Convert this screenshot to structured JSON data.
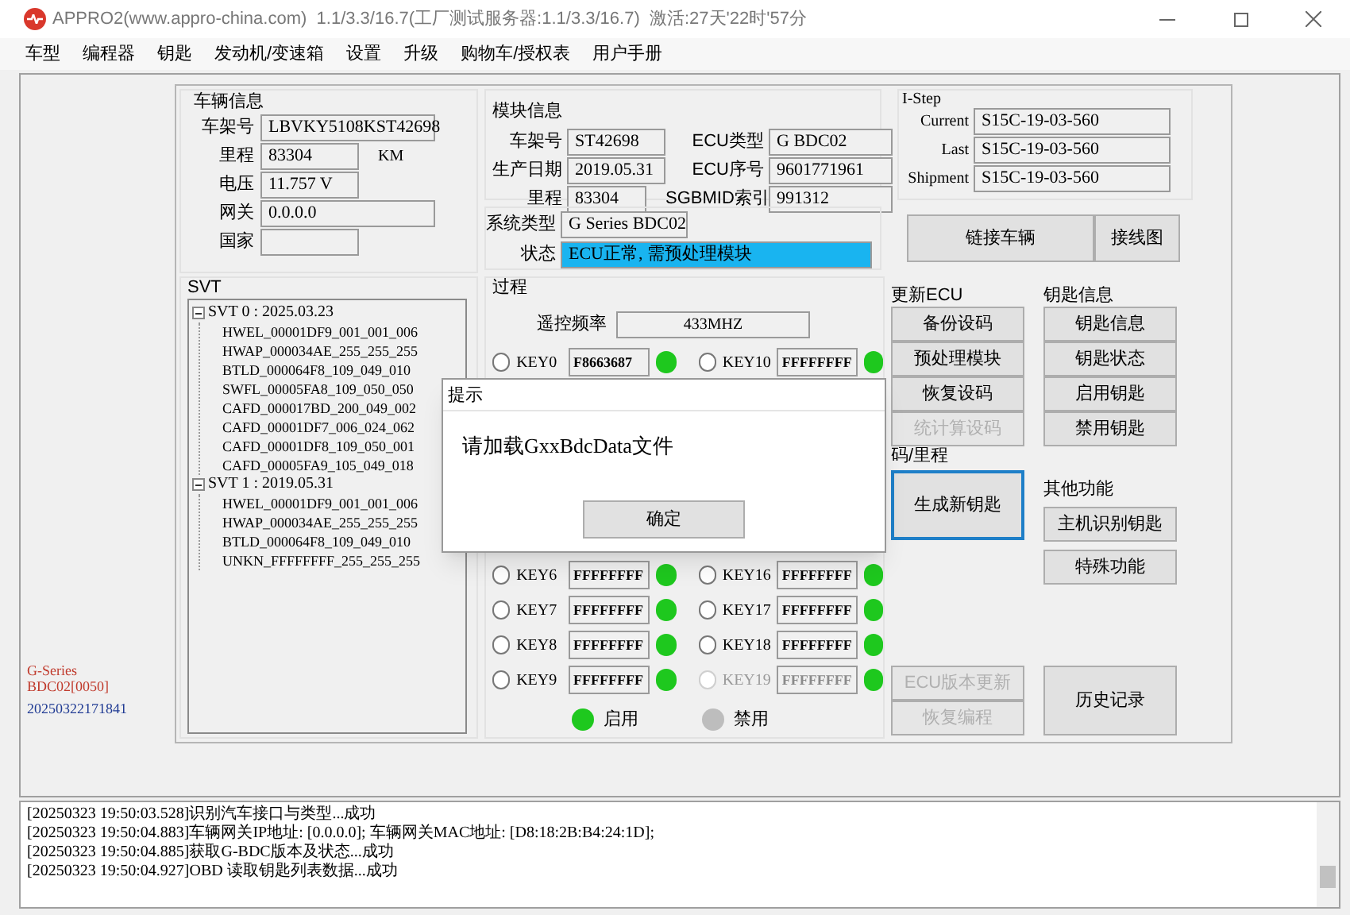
{
  "window": {
    "title": "APPRO2(www.appro-china.com)  1.1/3.3/16.7(工厂测试服务器:1.1/3.3/16.7)  激活:27天'22时'57分"
  },
  "menu": [
    "车型",
    "编程器",
    "钥匙",
    "发动机/变速箱",
    "设置",
    "升级",
    "购物车/授权表",
    "用户手册"
  ],
  "vehicle_info": {
    "title": "车辆信息",
    "fields": [
      {
        "label": "车架号",
        "value": "LBVKY5108KST42698"
      },
      {
        "label": "里程",
        "value": "83304",
        "unit": "KM"
      },
      {
        "label": "电压",
        "value": "11.757 V"
      },
      {
        "label": "网关",
        "value": "0.0.0.0"
      },
      {
        "label": "国家"
      }
    ]
  },
  "module_info": {
    "title": "模块信息",
    "fields": [
      {
        "label": "车架号",
        "value": "ST42698"
      },
      {
        "label": "ECU类型",
        "value": "G BDC02"
      },
      {
        "label": "生产日期",
        "value": "2019.05.31"
      },
      {
        "label": "ECU序号",
        "value": "9601771961"
      },
      {
        "label": "里程",
        "value": "83304"
      },
      {
        "label": "SGBMID索引",
        "value": "991312"
      }
    ]
  },
  "istep": {
    "title": "I-Step",
    "fields": [
      {
        "label": "Current",
        "value": "S15C-19-03-560"
      },
      {
        "label": "Last",
        "value": "S15C-19-03-560"
      },
      {
        "label": "Shipment",
        "value": "S15C-19-03-560"
      }
    ]
  },
  "system": {
    "type_label": "系统类型",
    "type_value": "G Series BDC02",
    "status_label": "状态",
    "status_value": "ECU正常, 需预处理模块",
    "status_highlighted": true
  },
  "connect_buttons": [
    "链接车辆",
    "接线图"
  ],
  "svt": {
    "title": "SVT",
    "tree": [
      {
        "label": "SVT 0 : 2025.03.23",
        "expanded": true,
        "children": [
          {
            "label": "HWEL_00001DF9_001_001_006"
          },
          {
            "label": "HWAP_000034AE_255_255_255"
          },
          {
            "label": "BTLD_000064F8_109_049_010"
          },
          {
            "label": "SWFL_00005FA8_109_050_050"
          },
          {
            "label": "CAFD_000017BD_200_049_002"
          },
          {
            "label": "CAFD_00001DF7_006_024_062"
          },
          {
            "label": "CAFD_00001DF8_109_050_001"
          },
          {
            "label": "CAFD_00005FA9_105_049_018"
          }
        ]
      },
      {
        "label": "SVT 1 : 2019.05.31",
        "expanded": true,
        "children": [
          {
            "label": "HWEL_00001DF9_001_001_006"
          },
          {
            "label": "HWAP_000034AE_255_255_255"
          },
          {
            "label": "BTLD_000064F8_109_049_010"
          },
          {
            "label": "UNKN_FFFFFFFF_255_255_255"
          }
        ]
      }
    ]
  },
  "side_info": [
    {
      "text": "G-Series",
      "color": "#c0392b"
    },
    {
      "text": "BDC02[0050]",
      "color": "#c0392b"
    },
    {
      "text": "20250322171841",
      "color": "#1f3a93"
    }
  ],
  "process": {
    "title": "过程",
    "frequency_label": "遥控频率",
    "frequency_value": "433MHZ",
    "keys": [
      {
        "label": "KEY0",
        "value": "F8663687",
        "selected": false,
        "disabled": false,
        "active": true
      },
      {
        "label": "KEY10",
        "value": "FFFFFFFF",
        "selected": false,
        "disabled": false,
        "active": true
      },
      {
        "label": "KEY6",
        "value": "FFFFFFFF",
        "selected": false,
        "disabled": false,
        "active": true
      },
      {
        "label": "KEY16",
        "value": "FFFFFFFF",
        "selected": false,
        "disabled": false,
        "active": true
      },
      {
        "label": "KEY7",
        "value": "FFFFFFFF",
        "selected": false,
        "disabled": false,
        "active": true
      },
      {
        "label": "KEY17",
        "value": "FFFFFFFF",
        "selected": false,
        "disabled": false,
        "active": true
      },
      {
        "label": "KEY8",
        "value": "FFFFFFFF",
        "selected": false,
        "disabled": false,
        "active": true
      },
      {
        "label": "KEY18",
        "value": "FFFFFFFF",
        "selected": false,
        "disabled": false,
        "active": true
      },
      {
        "label": "KEY9",
        "value": "FFFFFFFF",
        "selected": false,
        "disabled": false,
        "active": true
      },
      {
        "label": "KEY19",
        "value": "FFFFFFFF",
        "selected": false,
        "disabled": true,
        "active": true
      }
    ],
    "legend": [
      {
        "label": "启用",
        "active": true
      },
      {
        "label": "禁用",
        "active": false
      }
    ]
  },
  "ecu_update": {
    "title": "更新ECU",
    "buttons": [
      {
        "label": "备份设码",
        "disabled": false
      },
      {
        "label": "预处理模块",
        "disabled": false
      },
      {
        "label": "恢复设码",
        "disabled": false
      },
      {
        "label": "统计算设码",
        "disabled": true
      }
    ]
  },
  "key_section": {
    "title": "码/里程",
    "button": "生成新钥匙",
    "focused": true
  },
  "ecu_bottom_buttons": [
    {
      "label": "ECU版本更新",
      "disabled": true
    },
    {
      "label": "恢复编程",
      "disabled": true
    }
  ],
  "key_info": {
    "title": "钥匙信息",
    "buttons": [
      "钥匙信息",
      "钥匙状态",
      "启用钥匙",
      "禁用钥匙"
    ]
  },
  "other": {
    "title": "其他功能",
    "buttons": [
      "主机识别钥匙",
      "特殊功能"
    ]
  },
  "history_button": "历史记录",
  "log": [
    "[20250323 19:50:03.528]识别汽车接口与类型...成功",
    "[20250323 19:50:04.883]车辆网关IP地址: [0.0.0.0]; 车辆网关MAC地址: [D8:18:2B:B4:24:1D];",
    "[20250323 19:50:04.885]获取G-BDC版本及状态...成功",
    "[20250323 19:50:04.927]OBD 读取钥匙列表数据...成功"
  ],
  "dialog": {
    "title": "提示",
    "message": "请加载GxxBdcData文件",
    "button": "确定"
  }
}
